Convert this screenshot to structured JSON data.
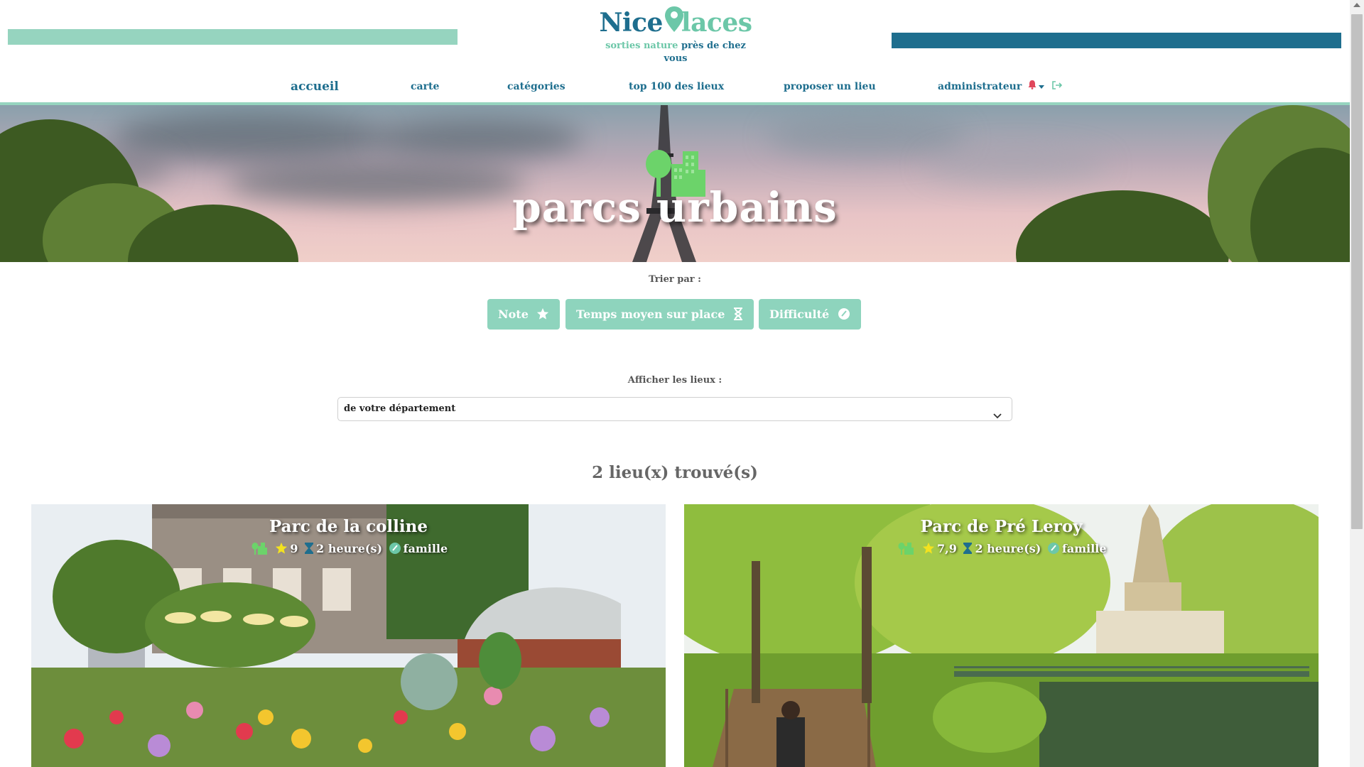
{
  "header": {
    "logo_word_1": "Nice",
    "logo_word_2": "laces",
    "tagline_part_1": "sorties nature",
    "tagline_part_2": "près de chez vous",
    "left_bar_color": "#96d4bf",
    "right_bar_color": "#1e6e8e"
  },
  "nav": {
    "items": [
      {
        "label": "accueil",
        "active": true
      },
      {
        "label": "carte"
      },
      {
        "label": "catégories"
      },
      {
        "label": "top 100 des lieux"
      },
      {
        "label": "proposer un lieu"
      },
      {
        "label": "administrateur",
        "icons": [
          "bell-icon",
          "caret-down-icon",
          "logout-icon"
        ]
      }
    ]
  },
  "hero": {
    "title": "parcs urbains",
    "icon": "park-city-icon"
  },
  "sort": {
    "label": "Trier par :",
    "buttons": [
      {
        "label": "Note",
        "icon": "star-icon"
      },
      {
        "label": "Temps moyen sur place",
        "icon": "hourglass-icon"
      },
      {
        "label": "Difficulté",
        "icon": "check-circle-icon"
      }
    ]
  },
  "filter": {
    "label": "Afficher les lieux :",
    "selected": "de votre département"
  },
  "results": {
    "count_text": "2 lieu(x) trouvé(s)",
    "places": [
      {
        "name": "Parc de la colline",
        "rating": "9",
        "duration": "2 heure(s)",
        "difficulty": "famille"
      },
      {
        "name": "Parc de Pré Leroy",
        "rating": "7,9",
        "duration": "2 heure(s)",
        "difficulty": "famille"
      }
    ]
  },
  "colors": {
    "primary": "#1e6e8e",
    "accent": "#8ed4bd",
    "icon_green": "#6cd36a",
    "star_yellow": "#f3e21f",
    "bell_red": "#e0475b"
  }
}
